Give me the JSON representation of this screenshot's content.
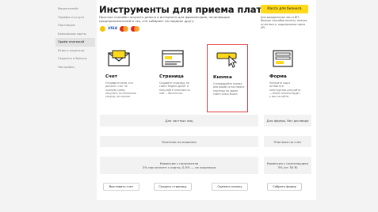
{
  "sidebar": {
    "items": [
      "Маркетплейс",
      "Тарифы и услуги",
      "Партнёрам",
      "Банковские карты",
      "Приём платежей",
      "Игры и подписки",
      "Гаджеты и бонусы",
      "Настройки"
    ],
    "active_index": 4
  },
  "header": {
    "title": "Инструменты для приема платежей",
    "subtitle": "Простые способы получить деньги в интернете для фрилансеров, начинающих предпринимателей и тех, кто собирает на подарок другу.",
    "payment_icons": [
      "yandex-money-icon",
      "visa-icon",
      "mastercard-icon",
      "mir-icon"
    ],
    "visa_label": "VISA"
  },
  "business": {
    "button_label": "Касса для бизнеса",
    "description": "Для юридических лиц и ИП: больше способов оплаты, полная отчетность, подключение через API."
  },
  "cards": [
    {
      "id": "schet",
      "title": "Счет",
      "description": "Отправьте всем, кто должен: счет на нужную сумму получите за несколько секунд, по ссылке.",
      "icon": "envelope-icon"
    },
    {
      "id": "stranitsa",
      "title": "Страница",
      "description": "Создайте страницу на сайте Яндекс.Денег и получайте платежи на ней — бесплатно.",
      "icon": "webpage-icon"
    },
    {
      "id": "knopka",
      "title": "Кнопка",
      "description": "Сгенерируйте кнопку или форму и поставьте платежи на своем сайте или в блоге.",
      "icon": "pay-button-icon"
    },
    {
      "id": "forma",
      "title": "Форма",
      "description": "Получите код и вставьте в конструктор для сайта — бланк оплаты будет у вас на сайте.",
      "icon": "form-icon"
    }
  ],
  "rows": {
    "individuals": "Для частных лиц",
    "businesses": "Для фирмы, без договора",
    "wallet_fees_left": "Платежи на кошелек",
    "wallet_fees_right": "Платежи на счет",
    "commission_left": "Комиссия с получателя\n2% при оплате с карты, 0,5% — из кошелька",
    "commission_right": "Комиссия с плательщика\n3% (от 30 ₽)"
  },
  "actions": {
    "bill": "Выставить счет",
    "page": "Создать страницу",
    "button": "Сделать кнопку",
    "form": "Собрать форму"
  },
  "colors": {
    "accent": "#ffd91a",
    "highlight": "#e23a3a"
  }
}
